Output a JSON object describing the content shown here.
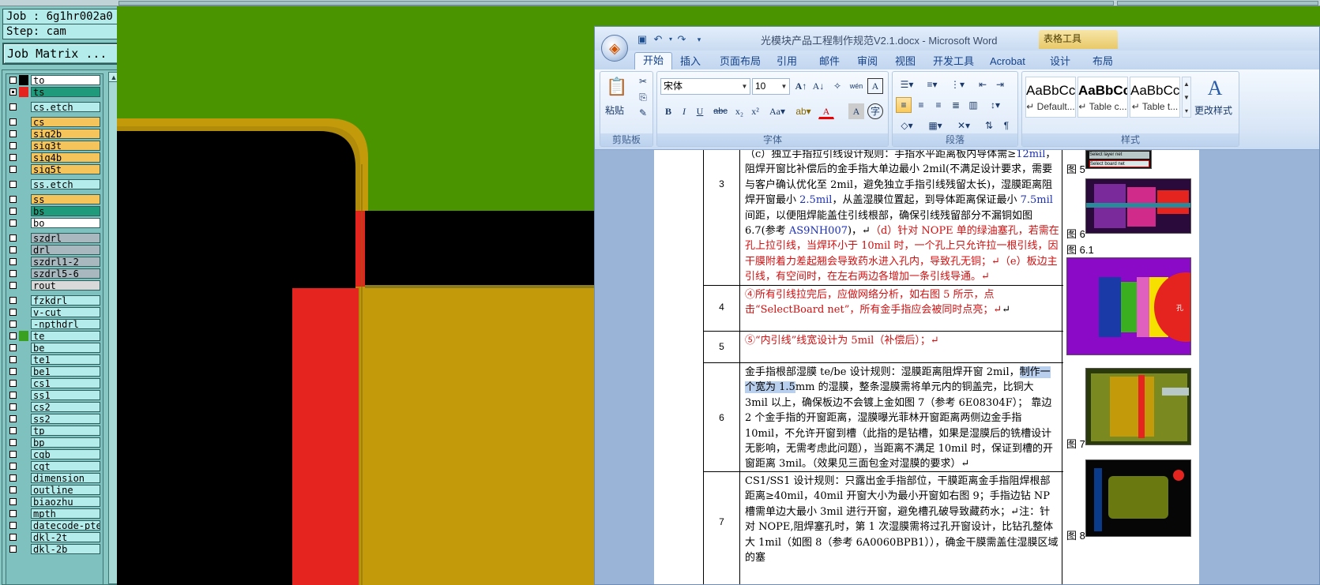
{
  "left_panel": {
    "job": "Job : 6g1hr002a0",
    "step": "Step: cam",
    "matrix_button": "Job Matrix ...",
    "layers": [
      {
        "name": "to",
        "color": "#ffffff",
        "swatch": "#000000",
        "visible": false
      },
      {
        "name": "ts",
        "color": "#1f9a7a",
        "swatch": "#e52420",
        "visible": true
      },
      {
        "name": "cs.etch",
        "color": "#b3ecea",
        "swatch": "",
        "visible": false
      },
      {
        "name": "cs",
        "color": "#f5c45a",
        "swatch": "",
        "visible": false
      },
      {
        "name": "sig2b",
        "color": "#f5c45a",
        "swatch": "",
        "visible": false
      },
      {
        "name": "sig3t",
        "color": "#f5c45a",
        "swatch": "",
        "visible": false
      },
      {
        "name": "sig4b",
        "color": "#f5c45a",
        "swatch": "",
        "visible": false
      },
      {
        "name": "sig5t",
        "color": "#f5c45a",
        "swatch": "",
        "visible": false
      },
      {
        "name": "ss.etch",
        "color": "#b3ecea",
        "swatch": "",
        "visible": false
      },
      {
        "name": "ss",
        "color": "#f5c45a",
        "swatch": "",
        "visible": false
      },
      {
        "name": "bs",
        "color": "#1f9a7a",
        "swatch": "",
        "visible": false
      },
      {
        "name": "bo",
        "color": "#ffffff",
        "swatch": "",
        "visible": false
      },
      {
        "name": "szdrl",
        "color": "#a9b8bf",
        "swatch": "",
        "visible": false
      },
      {
        "name": "drl",
        "color": "#a9b8bf",
        "swatch": "",
        "visible": false
      },
      {
        "name": "szdrl1-2",
        "color": "#a9b8bf",
        "swatch": "",
        "visible": false
      },
      {
        "name": "szdrl5-6",
        "color": "#a9b8bf",
        "swatch": "",
        "visible": false
      },
      {
        "name": "rout",
        "color": "#d9d9d9",
        "swatch": "",
        "visible": false
      },
      {
        "name": "fzkdrl",
        "color": "#b3ecea",
        "swatch": "",
        "visible": false
      },
      {
        "name": "v-cut",
        "color": "#b3ecea",
        "swatch": "",
        "visible": false
      },
      {
        "name": "-npthdrl",
        "color": "#b3ecea",
        "swatch": "",
        "visible": false
      },
      {
        "name": "te",
        "color": "#b3ecea",
        "swatch": "#3aa020",
        "visible": false
      },
      {
        "name": "be",
        "color": "#b3ecea",
        "swatch": "",
        "visible": false
      },
      {
        "name": "te1",
        "color": "#b3ecea",
        "swatch": "",
        "visible": false
      },
      {
        "name": "be1",
        "color": "#b3ecea",
        "swatch": "",
        "visible": false
      },
      {
        "name": "cs1",
        "color": "#b3ecea",
        "swatch": "",
        "visible": false
      },
      {
        "name": "ss1",
        "color": "#b3ecea",
        "swatch": "",
        "visible": false
      },
      {
        "name": "cs2",
        "color": "#b3ecea",
        "swatch": "",
        "visible": false
      },
      {
        "name": "ss2",
        "color": "#b3ecea",
        "swatch": "",
        "visible": false
      },
      {
        "name": "tp",
        "color": "#b3ecea",
        "swatch": "",
        "visible": false
      },
      {
        "name": "bp",
        "color": "#b3ecea",
        "swatch": "",
        "visible": false
      },
      {
        "name": "cgb",
        "color": "#b3ecea",
        "swatch": "",
        "visible": false
      },
      {
        "name": "cgt",
        "color": "#b3ecea",
        "swatch": "",
        "visible": false
      },
      {
        "name": "dimension",
        "color": "#b3ecea",
        "swatch": "",
        "visible": false
      },
      {
        "name": "outline",
        "color": "#b3ecea",
        "swatch": "",
        "visible": false
      },
      {
        "name": "biaozhu",
        "color": "#b3ecea",
        "swatch": "",
        "visible": false
      },
      {
        "name": "mpth",
        "color": "#b3ecea",
        "swatch": "",
        "visible": false
      },
      {
        "name": "datecode-pte",
        "color": "#b3ecea",
        "swatch": "",
        "visible": false
      },
      {
        "name": "dkl-2t",
        "color": "#b3ecea",
        "swatch": "",
        "visible": false
      },
      {
        "name": "dkl-2b",
        "color": "#b3ecea",
        "swatch": "",
        "visible": false
      }
    ]
  },
  "word": {
    "title": "光模块产品工程制作规范V2.1.docx - Microsoft Word",
    "contextual_tab_group": "表格工具",
    "tabs": [
      "开始",
      "插入",
      "页面布局",
      "引用",
      "邮件",
      "审阅",
      "视图",
      "开发工具",
      "Acrobat",
      "设计",
      "布局"
    ],
    "active_tab": "开始",
    "ribbon": {
      "clipboard": {
        "paste": "粘贴",
        "label": "剪贴板"
      },
      "font": {
        "name": "宋体",
        "size": "10",
        "label": "字体"
      },
      "paragraph": {
        "label": "段落"
      },
      "styles": {
        "label": "样式",
        "items": [
          {
            "sample": "AaBbCcI",
            "name": "↵ Default..."
          },
          {
            "sample": "AaBbCc",
            "name": "↵ Table c..."
          },
          {
            "sample": "AaBbCc",
            "name": "↵ Table t..."
          }
        ],
        "change_styles": "更改样式"
      }
    },
    "rows": [
      {
        "num": "3",
        "parts": [
          {
            "t": "（c）独立手指拉引线设计规则：手指水平距离板内导体需≥",
            "c": ""
          },
          {
            "t": "12mil",
            "c": "blue"
          },
          {
            "t": "，阻焊开窗比补偿后的金手指大单边最小 2mil(不满足设计要求，需要与客户确认优化至 2mil，避免独立手指引线残留太长)，湿膜距离阻焊开窗最小 ",
            "c": ""
          },
          {
            "t": "2.5mil",
            "c": "blue"
          },
          {
            "t": "，从盖湿膜位置起，到导体距离保证最小 ",
            "c": ""
          },
          {
            "t": "7.5mil",
            "c": "blue"
          },
          {
            "t": " 间距，以便阻焊能盖住引线根部，确保引线残留部分不漏铜如图 6.7(参考 ",
            "c": ""
          },
          {
            "t": "AS9NH007",
            "c": "blue"
          },
          {
            "t": ")，↵",
            "c": ""
          },
          {
            "t": "（d）针对 NOPE 单的绿油塞孔，若需在孔上拉引线，当焊环小于 10mil 时，一个孔上只允许拉一根引线，因干膜附着力差起翘会导致药水进入孔内，导致孔无铜；↵",
            "c": "red"
          },
          {
            "t": "（e）板边主引线，有空间时，在左右两边各增加一条引线导通。↵",
            "c": "red"
          }
        ]
      },
      {
        "num": "4",
        "parts": [
          {
            "t": "④所有引线拉完后，应做网络分析，如右图 5 所示，点击“SelectBoard net”，所有金手指应会被同时点亮；↵",
            "c": "red"
          },
          {
            "t": "↵",
            "c": ""
          }
        ]
      },
      {
        "num": "5",
        "parts": [
          {
            "t": "⑤“内引线”线宽设计为 5mil（补偿后）；↵",
            "c": "red"
          }
        ]
      },
      {
        "num": "6",
        "parts": [
          {
            "t": "金手指根部湿膜 te/be 设计规则：湿膜距离阻焊开窗 2mil，",
            "c": ""
          },
          {
            "t": "制作一个宽为 1.5",
            "c": "hl"
          },
          {
            "t": "mm 的湿膜，整条湿膜需将单元内的铜盖完，比铜大 3mil 以上，确保板边不会镀上金如图 7（参考 6E08304F）； 靠边 2 个金手指的开窗距离，湿膜曝光菲林开窗距离两侧边金手指 10mil，不允许开窗到槽（此指的是钻槽，如果是湿膜后的铣槽设计无影响，无需考虑此问题），当距离不满足 10mil 时，保证到槽的开窗距离 3mil。（效果见三面包金对湿膜的要求）↵",
            "c": ""
          }
        ]
      },
      {
        "num": "7",
        "parts": [
          {
            "t": "CS1/SS1 设计规则：只露出金手指部位，干膜距离金手指阻焊根部距离≥40mil，40mil 开窗大小为最小开窗如右图 9；手指边钻 NP 槽需单边大最小 3mil 进行开窗，避免槽孔破导致藏药水；↵",
            "c": ""
          },
          {
            "t": "注：针对 NOPE,阻焊塞孔时，第 1 次湿膜需将过孔开窗设计，比钻孔整体大 1mil（如图 8（参考 6A0060BPB1）），确金干膜需盖住湿膜区域的塞",
            "c": ""
          }
        ]
      }
    ],
    "figure_labels": [
      "图 5",
      "图 6",
      "图 6.1",
      "图 7",
      "图 8"
    ],
    "fig5_text": [
      "Select layer net",
      "Select board net"
    ],
    "fig61_text": "孔"
  }
}
